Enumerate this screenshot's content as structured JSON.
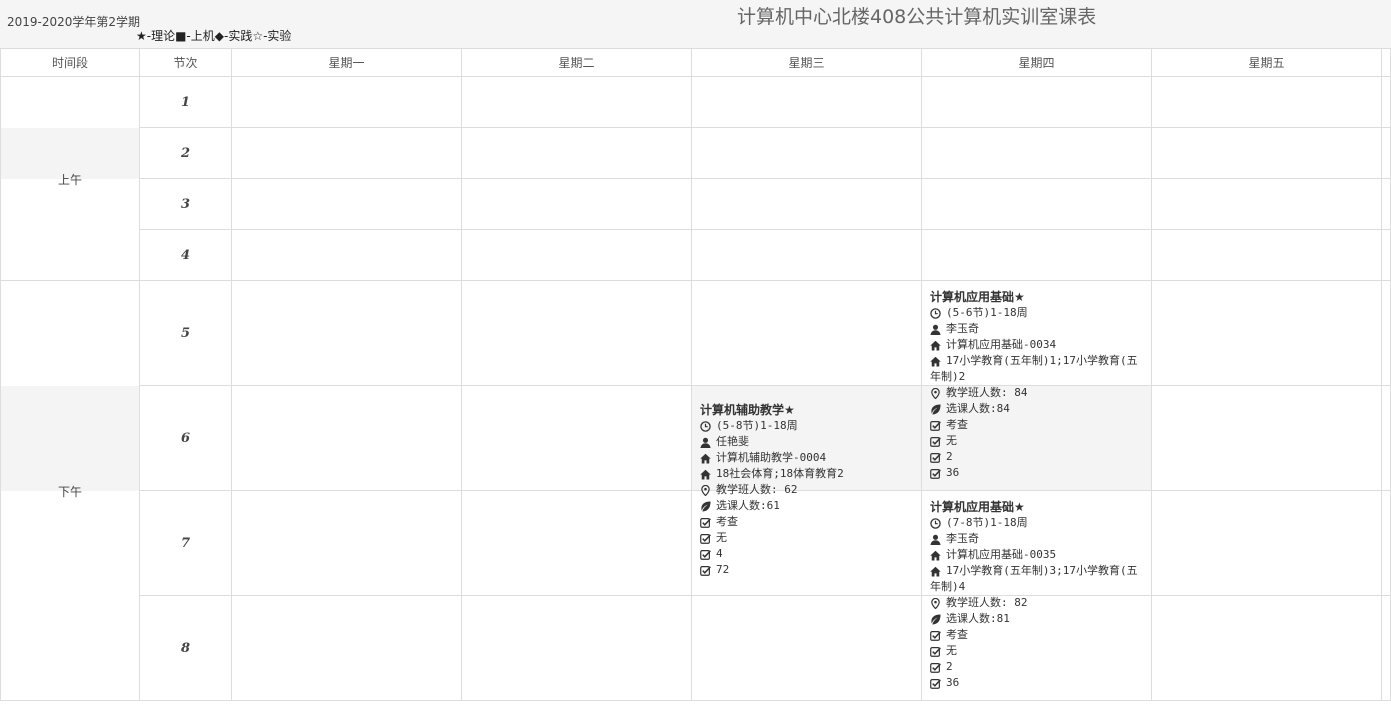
{
  "header": {
    "semester": "2019-2020学年第2学期",
    "legend": "★-理论■-上机◆-实践☆-实验",
    "title": "计算机中心北楼408公共计算机实训室课表"
  },
  "columns": {
    "period": "时间段",
    "slot": "节次",
    "days": [
      "星期一",
      "星期二",
      "星期三",
      "星期四",
      "星期五"
    ]
  },
  "periods": {
    "morning": "上午",
    "afternoon": "下午"
  },
  "slots": [
    "1",
    "2",
    "3",
    "4",
    "5",
    "6",
    "7",
    "8"
  ],
  "courses": [
    {
      "name": "计算机辅助教学★",
      "time": "(5-8节)1-18周",
      "teacher": "任艳斐",
      "room": "计算机辅助教学-0004",
      "classes": "18社会体育;18体育教育2",
      "class_size": "教学班人数: 62",
      "enrolled": "选课人数:61",
      "assessment": "考查",
      "extra1": "无",
      "extra2": "4",
      "extra3": "72"
    },
    {
      "name": "计算机应用基础★",
      "time": "(5-6节)1-18周",
      "teacher": "李玉奇",
      "room": "计算机应用基础-0034",
      "classes": "17小学教育(五年制)1;17小学教育(五年制)2",
      "class_size": "教学班人数: 84",
      "enrolled": "选课人数:84",
      "assessment": "考查",
      "extra1": "无",
      "extra2": "2",
      "extra3": "36"
    },
    {
      "name": "计算机应用基础★",
      "time": "(7-8节)1-18周",
      "teacher": "李玉奇",
      "room": "计算机应用基础-0035",
      "classes": "17小学教育(五年制)3;17小学教育(五年制)4",
      "class_size": "教学班人数: 82",
      "enrolled": "选课人数:81",
      "assessment": "考查",
      "extra1": "无",
      "extra2": "2",
      "extra3": "36"
    }
  ]
}
